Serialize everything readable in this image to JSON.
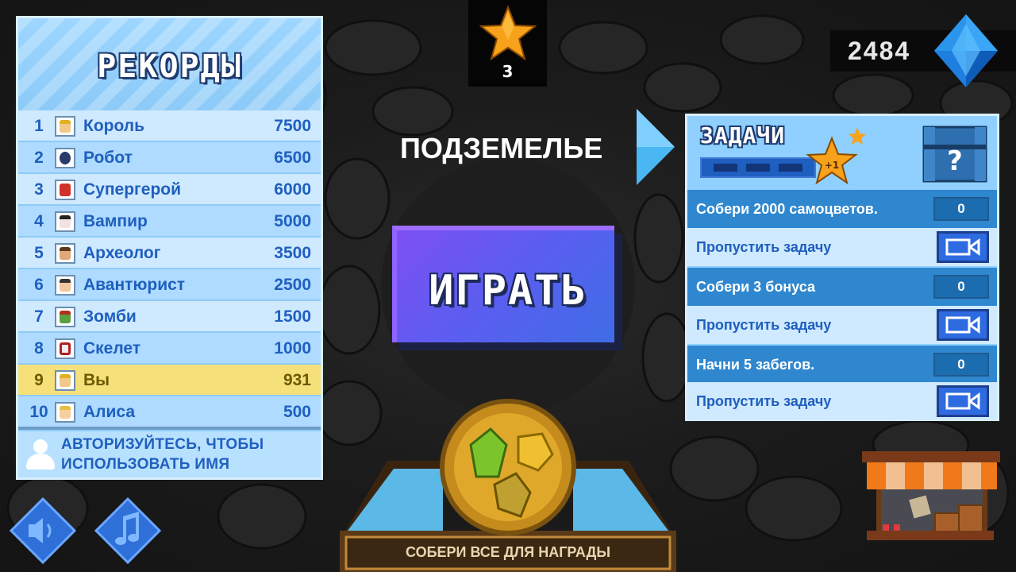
{
  "records": {
    "title": "РЕКОРДЫ",
    "rows": [
      {
        "rank": "1",
        "name": "Король",
        "score": "7500"
      },
      {
        "rank": "2",
        "name": "Робот",
        "score": "6500"
      },
      {
        "rank": "3",
        "name": "Супергерой",
        "score": "6000"
      },
      {
        "rank": "4",
        "name": "Вампир",
        "score": "5000"
      },
      {
        "rank": "5",
        "name": "Археолог",
        "score": "3500"
      },
      {
        "rank": "6",
        "name": "Авантюрист",
        "score": "2500"
      },
      {
        "rank": "7",
        "name": "Зомби",
        "score": "1500"
      },
      {
        "rank": "8",
        "name": "Скелет",
        "score": "1000"
      },
      {
        "rank": "9",
        "name": "Вы",
        "score": "931"
      },
      {
        "rank": "10",
        "name": "Алиса",
        "score": "500"
      }
    ],
    "auth_line1": "АВТОРИЗУЙТЕСЬ, ЧТОБЫ",
    "auth_line2": "ИСПОЛЬЗОВАТЬ ИМЯ"
  },
  "stars": {
    "count": "3"
  },
  "gems": {
    "count": "2484"
  },
  "location": {
    "label": "ПОДЗЕМЕЛЬЕ"
  },
  "play": {
    "label": "ИГРАТЬ"
  },
  "tasks": {
    "title": "ЗАДАЧИ",
    "star_bonus": "+1",
    "chest_symbol": "?",
    "items": [
      {
        "goal": "Собери 2000 самоцветов.",
        "count": "0",
        "skip": "Пропустить задачу"
      },
      {
        "goal": "Собери 3 бонуса",
        "count": "0",
        "skip": "Пропустить задачу"
      },
      {
        "goal": "Начни 5 забегов.",
        "count": "0",
        "skip": "Пропустить задачу"
      }
    ]
  },
  "reward": {
    "label": "СОБЕРИ ВСЕ ДЛЯ НАГРАДЫ"
  },
  "colors": {
    "panel": "#8fd0ff",
    "row_light": "#cfe9ff",
    "row_dark": "#aedbff",
    "highlight_row": "#f5e07a",
    "text_blue": "#1f5fbf",
    "play_button": "#5a5ef0"
  },
  "icons": {
    "star": "star-icon",
    "gem": "blue-gem-icon",
    "arrow": "arrow-right-icon",
    "chest": "chest-icon",
    "video": "video-camera-icon",
    "sound": "speaker-icon",
    "music": "music-note-icon",
    "shop": "shop-stall-icon",
    "user": "user-silhouette-icon"
  }
}
